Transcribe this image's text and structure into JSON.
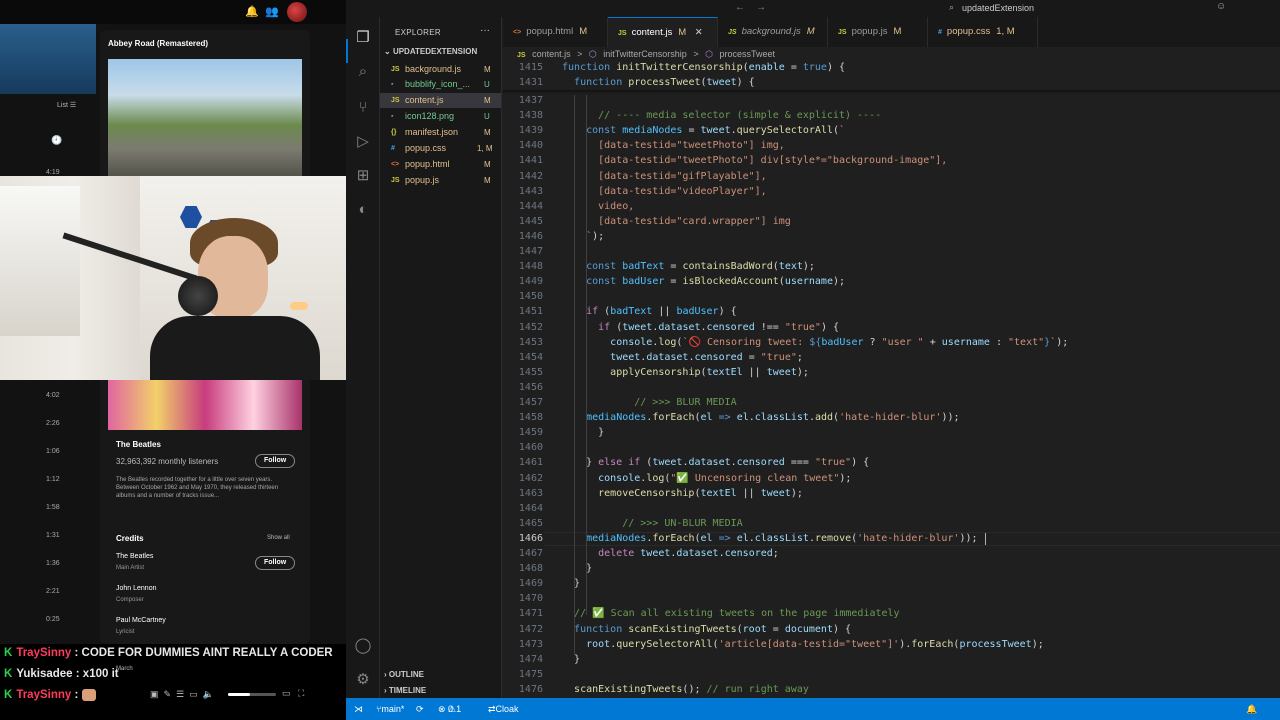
{
  "spotify": {
    "album_title": "Abbey Road (Remastered)",
    "list_label": "List",
    "durations": [
      "4:19",
      "4:02",
      "2:26",
      "1:06",
      "1:12",
      "1:58",
      "1:31",
      "1:36",
      "2:21",
      "0:25"
    ],
    "artist": "The Beatles",
    "monthly_listeners": "32,963,392 monthly listeners",
    "follow_label": "Follow",
    "bio": "The Beatles recorded together for a little over seven years. Between October 1962 and May 1970, they released thirteen albums and a number of tracks issue...",
    "credits_title": "Credits",
    "show_all": "Show all",
    "credits": [
      {
        "name": "The Beatles",
        "role": "Main Artist"
      },
      {
        "name": "John Lennon",
        "role": "Composer"
      },
      {
        "name": "Paul McCartney",
        "role": "Lyricist"
      }
    ],
    "partial_row": "March",
    "volume_fraction": 0.45
  },
  "chat": [
    {
      "user": "TraySinny",
      "message": ": CODE FOR DUMMIES AINT REALLY A CODER"
    },
    {
      "user": "Yukisadee",
      "message": ": x100 it"
    },
    {
      "user": "TraySinny",
      "message": ":"
    }
  ],
  "vscode": {
    "title": "updatedExtension",
    "explorer_title": "EXPLORER",
    "folder": "UPDATEDEXTENSION",
    "files": [
      {
        "name": "background.js",
        "icon": "JS",
        "status": "M"
      },
      {
        "name": "bubblify_icon_...",
        "icon": "▪",
        "status": "U"
      },
      {
        "name": "content.js",
        "icon": "JS",
        "status": "M"
      },
      {
        "name": "icon128.png",
        "icon": "▪",
        "status": "U"
      },
      {
        "name": "manifest.json",
        "icon": "{}",
        "status": "M"
      },
      {
        "name": "popup.css",
        "icon": "#",
        "status": "1, M"
      },
      {
        "name": "popup.html",
        "icon": "<>",
        "status": "M"
      },
      {
        "name": "popup.js",
        "icon": "JS",
        "status": "M"
      }
    ],
    "outline": "OUTLINE",
    "timeline": "TIMELINE",
    "tabs": [
      {
        "icon": "<>",
        "name": "popup.html",
        "mark": "M"
      },
      {
        "icon": "JS",
        "name": "content.js",
        "mark": "M"
      },
      {
        "icon": "JS",
        "name": "background.js",
        "mark": "M"
      },
      {
        "icon": "JS",
        "name": "popup.js",
        "mark": "M"
      },
      {
        "icon": "#",
        "name": "popup.css",
        "mark": "1, M"
      }
    ],
    "breadcrumb": [
      "content.js",
      ">",
      "initTwitterCensorship",
      ">",
      "processTweet"
    ],
    "sticky_lines": [
      {
        "n": "1415",
        "html": "<span class=\"bl\">function</span> <span class=\"fn2\">initTwitterCensorship</span>(<span class=\"var\">enable</span> = <span class=\"bl\">true</span>) {"
      },
      {
        "n": "1431",
        "html": "  <span class=\"bl\">function</span> <span class=\"fn2\">processTweet</span>(<span class=\"var\">tweet</span>) {"
      }
    ],
    "code_lines": [
      {
        "n": "1437",
        "html": ""
      },
      {
        "n": "1438",
        "html": "      <span class=\"cm\">// ---- media selector (simple &amp; explicit) ----</span>"
      },
      {
        "n": "1439",
        "html": "    <span class=\"bl\">const</span> <span class=\"cst\">mediaNodes</span> = <span class=\"var\">tweet</span>.<span class=\"fn2\">querySelectorAll</span>(<span class=\"str\">`</span>"
      },
      {
        "n": "1440",
        "html": "<span class=\"str\">      [data-testid=\"tweetPhoto\"] img,</span>"
      },
      {
        "n": "1441",
        "html": "<span class=\"str\">      [data-testid=\"tweetPhoto\"] div[style*=\"background-image\"],</span>"
      },
      {
        "n": "1442",
        "html": "<span class=\"str\">      [data-testid=\"gifPlayable\"],</span>"
      },
      {
        "n": "1443",
        "html": "<span class=\"str\">      [data-testid=\"videoPlayer\"],</span>"
      },
      {
        "n": "1444",
        "html": "<span class=\"str\">      video,</span>"
      },
      {
        "n": "1445",
        "html": "<span class=\"str\">      [data-testid=\"card.wrapper\"] img</span>"
      },
      {
        "n": "1446",
        "html": "<span class=\"str\">    `</span>);"
      },
      {
        "n": "1447",
        "html": ""
      },
      {
        "n": "1448",
        "html": "    <span class=\"bl\">const</span> <span class=\"cst\">badText</span> = <span class=\"fn2\">containsBadWord</span>(<span class=\"var\">text</span>);"
      },
      {
        "n": "1449",
        "html": "    <span class=\"bl\">const</span> <span class=\"cst\">badUser</span> = <span class=\"fn2\">isBlockedAccount</span>(<span class=\"var\">username</span>);"
      },
      {
        "n": "1450",
        "html": ""
      },
      {
        "n": "1451",
        "html": "    <span class=\"kw\">if</span> (<span class=\"cst\">badText</span> || <span class=\"cst\">badUser</span>) {"
      },
      {
        "n": "1452",
        "html": "      <span class=\"kw\">if</span> (<span class=\"var\">tweet</span>.<span class=\"var\">dataset</span>.<span class=\"var\">censored</span> !== <span class=\"str\">\"true\"</span>) {"
      },
      {
        "n": "1453",
        "html": "        <span class=\"var\">console</span>.<span class=\"fn2\">log</span>(<span class=\"str\">`🚫 Censoring tweet: </span><span class=\"bl\">${</span><span class=\"cst\">badUser</span> ? <span class=\"str\">\"user \"</span> + <span class=\"var\">username</span> : <span class=\"str\">\"text\"</span><span class=\"bl\">}</span><span class=\"str\">`</span>);"
      },
      {
        "n": "1454",
        "html": "        <span class=\"var\">tweet</span>.<span class=\"var\">dataset</span>.<span class=\"var\">censored</span> = <span class=\"str\">\"true\"</span>;"
      },
      {
        "n": "1455",
        "html": "        <span class=\"fn2\">applyCensorship</span>(<span class=\"var\">textEl</span> || <span class=\"var\">tweet</span>);"
      },
      {
        "n": "1456",
        "html": ""
      },
      {
        "n": "1457",
        "html": "            <span class=\"cm\">// &gt;&gt;&gt; BLUR MEDIA</span>"
      },
      {
        "n": "1458",
        "html": "    <span class=\"cst\">mediaNodes</span>.<span class=\"fn2\">forEach</span>(<span class=\"var\">el</span> <span class=\"bl\">=&gt;</span> <span class=\"var\">el</span>.<span class=\"var\">classList</span>.<span class=\"fn2\">add</span>(<span class=\"str\">'hate-hider-blur'</span>));"
      },
      {
        "n": "1459",
        "html": "      }"
      },
      {
        "n": "1460",
        "html": ""
      },
      {
        "n": "1461",
        "html": "    } <span class=\"kw\">else if</span> (<span class=\"var\">tweet</span>.<span class=\"var\">dataset</span>.<span class=\"var\">censored</span> === <span class=\"str\">\"true\"</span>) {"
      },
      {
        "n": "1462",
        "html": "      <span class=\"var\">console</span>.<span class=\"fn2\">log</span>(<span class=\"str\">\"✅ Uncensoring clean tweet\"</span>);"
      },
      {
        "n": "1463",
        "html": "      <span class=\"fn2\">removeCensorship</span>(<span class=\"var\">textEl</span> || <span class=\"var\">tweet</span>);"
      },
      {
        "n": "1464",
        "html": ""
      },
      {
        "n": "1465",
        "html": "          <span class=\"cm\">// &gt;&gt;&gt; UN-BLUR MEDIA</span>"
      },
      {
        "n": "1466",
        "html": "    <span class=\"cst\">mediaNodes</span>.<span class=\"fn2\">forEach</span>(<span class=\"var\">el</span> <span class=\"bl\">=&gt;</span> <span class=\"var\">el</span>.<span class=\"var\">classList</span>.<span class=\"fn2\">remove</span>(<span class=\"str\">'hate-hider-blur'</span>));"
      },
      {
        "n": "1467",
        "html": "      <span class=\"kw\">delete</span> <span class=\"var\">tweet</span>.<span class=\"var\">dataset</span>.<span class=\"var\">censored</span>;"
      },
      {
        "n": "1468",
        "html": "    }"
      },
      {
        "n": "1469",
        "html": "  }"
      },
      {
        "n": "1470",
        "html": ""
      },
      {
        "n": "1471",
        "html": "  <span class=\"cm\">// ✅ Scan all existing tweets on the page immediately</span>"
      },
      {
        "n": "1472",
        "html": "  <span class=\"bl\">function</span> <span class=\"fn2\">scanExistingTweets</span>(<span class=\"var\">root</span> = <span class=\"var\">document</span>) {"
      },
      {
        "n": "1473",
        "html": "    <span class=\"var\">root</span>.<span class=\"fn2\">querySelectorAll</span>(<span class=\"str\">'article[data-testid=\"tweet\"]'</span>).<span class=\"fn2\">forEach</span>(<span class=\"var\">processTweet</span>);"
      },
      {
        "n": "1474",
        "html": "  }"
      },
      {
        "n": "1475",
        "html": ""
      },
      {
        "n": "1476",
        "html": "  <span class=\"fn2\">scanExistingTweets</span>(); <span class=\"cm\">// run right away</span>"
      }
    ],
    "current_line": "1466",
    "status": {
      "branch": "main*",
      "errors": "0",
      "warnings": "1",
      "extension": "Cloak"
    }
  }
}
